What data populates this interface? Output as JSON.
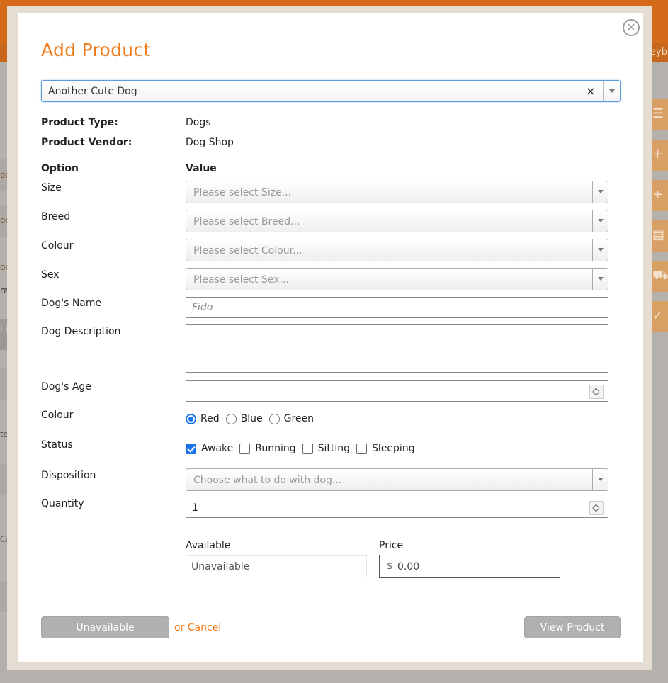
{
  "background": {
    "fragments": [
      "oo",
      "on",
      "oi",
      "re",
      "l i",
      "to",
      "Ch"
    ],
    "right_fragment": "eybo",
    "side_icons": [
      "list-icon",
      "plus-icon",
      "plus-icon",
      "document-plus-icon",
      "cart-icon",
      "checkmark-icon"
    ]
  },
  "modal": {
    "title": "Add Product",
    "close_symbol": "✕",
    "product_select": {
      "value": "Another Cute Dog",
      "clear_symbol": "×"
    },
    "product_type_label": "Product Type:",
    "product_type_value": "Dogs",
    "product_vendor_label": "Product Vendor:",
    "product_vendor_value": "Dog Shop",
    "option_header": "Option",
    "value_header": "Value",
    "fields": {
      "size": {
        "label": "Size",
        "placeholder": "Please select Size..."
      },
      "breed": {
        "label": "Breed",
        "placeholder": "Please select Breed..."
      },
      "colour_select": {
        "label": "Colour",
        "placeholder": "Please select Colour..."
      },
      "sex": {
        "label": "Sex",
        "placeholder": "Please select Sex..."
      },
      "dog_name": {
        "label": "Dog's Name",
        "placeholder": "Fido",
        "value": ""
      },
      "dog_description": {
        "label": "Dog Description",
        "value": ""
      },
      "dog_age": {
        "label": "Dog's Age",
        "value": ""
      },
      "colour_radio": {
        "label": "Colour",
        "options": [
          "Red",
          "Blue",
          "Green"
        ],
        "selected": "Red"
      },
      "status": {
        "label": "Status",
        "options": [
          "Awake",
          "Running",
          "Sitting",
          "Sleeping"
        ],
        "checked": [
          "Awake"
        ]
      },
      "disposition": {
        "label": "Disposition",
        "placeholder": "Choose what to do with dog..."
      },
      "quantity": {
        "label": "Quantity",
        "value": "1"
      }
    },
    "available": {
      "label": "Available",
      "value": "Unavailable"
    },
    "price": {
      "label": "Price",
      "currency": "$",
      "value": "0.00"
    },
    "footer": {
      "primary_button": "Unavailable",
      "or_text": "or Cancel",
      "view_button": "View Product"
    },
    "accent_color": "#f07c1b",
    "selected_color": "#1a73e8"
  }
}
